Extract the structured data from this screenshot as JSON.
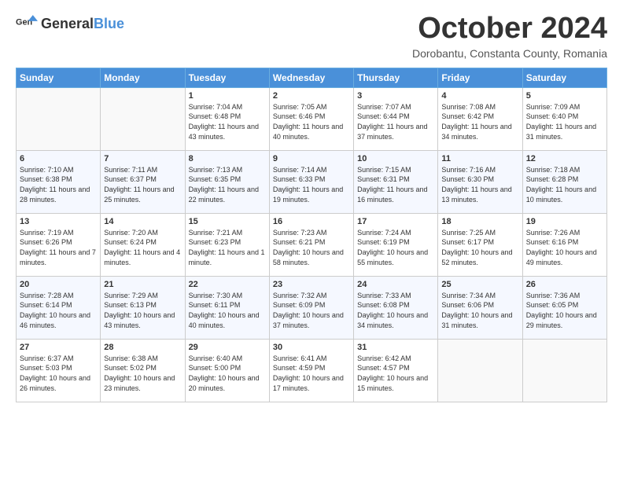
{
  "header": {
    "logo_general": "General",
    "logo_blue": "Blue",
    "month": "October 2024",
    "location": "Dorobantu, Constanta County, Romania"
  },
  "days_of_week": [
    "Sunday",
    "Monday",
    "Tuesday",
    "Wednesday",
    "Thursday",
    "Friday",
    "Saturday"
  ],
  "weeks": [
    [
      {
        "day": "",
        "sunrise": "",
        "sunset": "",
        "daylight": ""
      },
      {
        "day": "",
        "sunrise": "",
        "sunset": "",
        "daylight": ""
      },
      {
        "day": "1",
        "sunrise": "Sunrise: 7:04 AM",
        "sunset": "Sunset: 6:48 PM",
        "daylight": "Daylight: 11 hours and 43 minutes."
      },
      {
        "day": "2",
        "sunrise": "Sunrise: 7:05 AM",
        "sunset": "Sunset: 6:46 PM",
        "daylight": "Daylight: 11 hours and 40 minutes."
      },
      {
        "day": "3",
        "sunrise": "Sunrise: 7:07 AM",
        "sunset": "Sunset: 6:44 PM",
        "daylight": "Daylight: 11 hours and 37 minutes."
      },
      {
        "day": "4",
        "sunrise": "Sunrise: 7:08 AM",
        "sunset": "Sunset: 6:42 PM",
        "daylight": "Daylight: 11 hours and 34 minutes."
      },
      {
        "day": "5",
        "sunrise": "Sunrise: 7:09 AM",
        "sunset": "Sunset: 6:40 PM",
        "daylight": "Daylight: 11 hours and 31 minutes."
      }
    ],
    [
      {
        "day": "6",
        "sunrise": "Sunrise: 7:10 AM",
        "sunset": "Sunset: 6:38 PM",
        "daylight": "Daylight: 11 hours and 28 minutes."
      },
      {
        "day": "7",
        "sunrise": "Sunrise: 7:11 AM",
        "sunset": "Sunset: 6:37 PM",
        "daylight": "Daylight: 11 hours and 25 minutes."
      },
      {
        "day": "8",
        "sunrise": "Sunrise: 7:13 AM",
        "sunset": "Sunset: 6:35 PM",
        "daylight": "Daylight: 11 hours and 22 minutes."
      },
      {
        "day": "9",
        "sunrise": "Sunrise: 7:14 AM",
        "sunset": "Sunset: 6:33 PM",
        "daylight": "Daylight: 11 hours and 19 minutes."
      },
      {
        "day": "10",
        "sunrise": "Sunrise: 7:15 AM",
        "sunset": "Sunset: 6:31 PM",
        "daylight": "Daylight: 11 hours and 16 minutes."
      },
      {
        "day": "11",
        "sunrise": "Sunrise: 7:16 AM",
        "sunset": "Sunset: 6:30 PM",
        "daylight": "Daylight: 11 hours and 13 minutes."
      },
      {
        "day": "12",
        "sunrise": "Sunrise: 7:18 AM",
        "sunset": "Sunset: 6:28 PM",
        "daylight": "Daylight: 11 hours and 10 minutes."
      }
    ],
    [
      {
        "day": "13",
        "sunrise": "Sunrise: 7:19 AM",
        "sunset": "Sunset: 6:26 PM",
        "daylight": "Daylight: 11 hours and 7 minutes."
      },
      {
        "day": "14",
        "sunrise": "Sunrise: 7:20 AM",
        "sunset": "Sunset: 6:24 PM",
        "daylight": "Daylight: 11 hours and 4 minutes."
      },
      {
        "day": "15",
        "sunrise": "Sunrise: 7:21 AM",
        "sunset": "Sunset: 6:23 PM",
        "daylight": "Daylight: 11 hours and 1 minute."
      },
      {
        "day": "16",
        "sunrise": "Sunrise: 7:23 AM",
        "sunset": "Sunset: 6:21 PM",
        "daylight": "Daylight: 10 hours and 58 minutes."
      },
      {
        "day": "17",
        "sunrise": "Sunrise: 7:24 AM",
        "sunset": "Sunset: 6:19 PM",
        "daylight": "Daylight: 10 hours and 55 minutes."
      },
      {
        "day": "18",
        "sunrise": "Sunrise: 7:25 AM",
        "sunset": "Sunset: 6:17 PM",
        "daylight": "Daylight: 10 hours and 52 minutes."
      },
      {
        "day": "19",
        "sunrise": "Sunrise: 7:26 AM",
        "sunset": "Sunset: 6:16 PM",
        "daylight": "Daylight: 10 hours and 49 minutes."
      }
    ],
    [
      {
        "day": "20",
        "sunrise": "Sunrise: 7:28 AM",
        "sunset": "Sunset: 6:14 PM",
        "daylight": "Daylight: 10 hours and 46 minutes."
      },
      {
        "day": "21",
        "sunrise": "Sunrise: 7:29 AM",
        "sunset": "Sunset: 6:13 PM",
        "daylight": "Daylight: 10 hours and 43 minutes."
      },
      {
        "day": "22",
        "sunrise": "Sunrise: 7:30 AM",
        "sunset": "Sunset: 6:11 PM",
        "daylight": "Daylight: 10 hours and 40 minutes."
      },
      {
        "day": "23",
        "sunrise": "Sunrise: 7:32 AM",
        "sunset": "Sunset: 6:09 PM",
        "daylight": "Daylight: 10 hours and 37 minutes."
      },
      {
        "day": "24",
        "sunrise": "Sunrise: 7:33 AM",
        "sunset": "Sunset: 6:08 PM",
        "daylight": "Daylight: 10 hours and 34 minutes."
      },
      {
        "day": "25",
        "sunrise": "Sunrise: 7:34 AM",
        "sunset": "Sunset: 6:06 PM",
        "daylight": "Daylight: 10 hours and 31 minutes."
      },
      {
        "day": "26",
        "sunrise": "Sunrise: 7:36 AM",
        "sunset": "Sunset: 6:05 PM",
        "daylight": "Daylight: 10 hours and 29 minutes."
      }
    ],
    [
      {
        "day": "27",
        "sunrise": "Sunrise: 6:37 AM",
        "sunset": "Sunset: 5:03 PM",
        "daylight": "Daylight: 10 hours and 26 minutes."
      },
      {
        "day": "28",
        "sunrise": "Sunrise: 6:38 AM",
        "sunset": "Sunset: 5:02 PM",
        "daylight": "Daylight: 10 hours and 23 minutes."
      },
      {
        "day": "29",
        "sunrise": "Sunrise: 6:40 AM",
        "sunset": "Sunset: 5:00 PM",
        "daylight": "Daylight: 10 hours and 20 minutes."
      },
      {
        "day": "30",
        "sunrise": "Sunrise: 6:41 AM",
        "sunset": "Sunset: 4:59 PM",
        "daylight": "Daylight: 10 hours and 17 minutes."
      },
      {
        "day": "31",
        "sunrise": "Sunrise: 6:42 AM",
        "sunset": "Sunset: 4:57 PM",
        "daylight": "Daylight: 10 hours and 15 minutes."
      },
      {
        "day": "",
        "sunrise": "",
        "sunset": "",
        "daylight": ""
      },
      {
        "day": "",
        "sunrise": "",
        "sunset": "",
        "daylight": ""
      }
    ]
  ]
}
